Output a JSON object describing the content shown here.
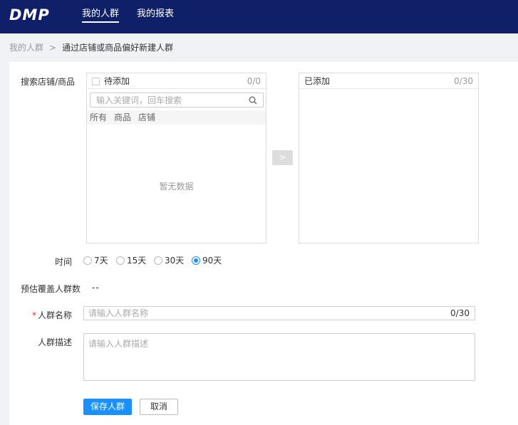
{
  "header": {
    "logo_text": "DMP",
    "nav": [
      {
        "label": "我的人群",
        "active": true
      },
      {
        "label": "我的报表",
        "active": false
      }
    ]
  },
  "breadcrumb": {
    "parent": "我的人群",
    "separator": ">",
    "current": "通过店铺或商品偏好新建人群"
  },
  "form": {
    "search_label": "搜索店铺/商品",
    "source": {
      "title": "待添加",
      "count": "0/0",
      "search_placeholder": "输入关键词，回车搜索",
      "filters": [
        "所有",
        "商品",
        "店铺"
      ],
      "empty_text": "暂无数据"
    },
    "move_button": ">",
    "target": {
      "title": "已添加",
      "count": "0/30"
    },
    "time_label": "时间",
    "time_options": [
      {
        "label": "7天",
        "checked": false
      },
      {
        "label": "15天",
        "checked": false
      },
      {
        "label": "30天",
        "checked": false
      },
      {
        "label": "90天",
        "checked": true
      }
    ],
    "estimate_label": "预估覆盖人群数",
    "estimate_value": "--",
    "name_required_mark": "*",
    "name_label": "人群名称",
    "name_placeholder": "请输入人群名称",
    "name_count": "0/30",
    "desc_label": "人群描述",
    "desc_placeholder": "请输入人群描述",
    "save_label": "保存人群",
    "cancel_label": "取消"
  },
  "colors": {
    "header_bg": "#0f2069",
    "primary": "#1890ff",
    "required": "#f5222d"
  }
}
